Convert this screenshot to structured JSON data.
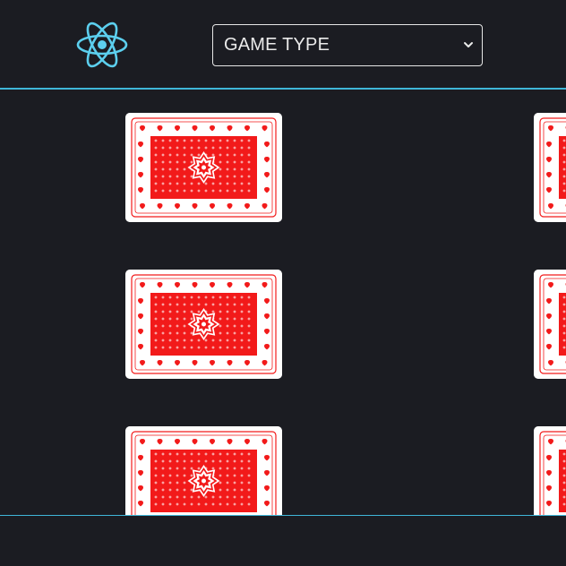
{
  "header": {
    "logo_icon": "react-atom-icon",
    "game_select": {
      "selected_label": "GAME TYPE",
      "chevron_icon": "chevron-down-icon"
    }
  },
  "board": {
    "card_back_icon": "playing-card-back-icon",
    "cards": [
      {
        "row": 1,
        "col": 1,
        "face": "down"
      },
      {
        "row": 1,
        "col": 2,
        "face": "down"
      },
      {
        "row": 2,
        "col": 1,
        "face": "down"
      },
      {
        "row": 2,
        "col": 2,
        "face": "down"
      },
      {
        "row": 3,
        "col": 1,
        "face": "down"
      },
      {
        "row": 3,
        "col": 2,
        "face": "down"
      }
    ]
  },
  "colors": {
    "background": "#1b1c22",
    "accent": "#3fb6d8",
    "card_red": "#f21a1a",
    "select_border": "#e6e6e6"
  }
}
